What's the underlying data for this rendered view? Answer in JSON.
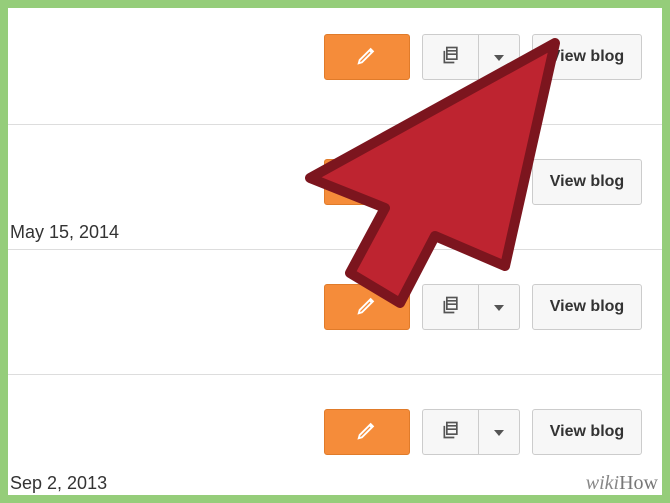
{
  "rows": [
    {
      "date": "",
      "view_label": "View blog"
    },
    {
      "date": "May 15, 2014",
      "view_label": "View blog"
    },
    {
      "date": "",
      "view_label": "View blog"
    },
    {
      "date": "Sep 2, 2013",
      "view_label": "View blog"
    }
  ],
  "icons": {
    "pencil": "pencil-icon",
    "posts": "posts-icon",
    "dropdown": "chevron-down-icon"
  },
  "watermark": {
    "prefix": "wiki",
    "suffix": "How"
  },
  "colors": {
    "frame": "#95cd7a",
    "edit_bg": "#f58c3a",
    "cursor_fill": "#be2430",
    "cursor_stroke": "#7c151e"
  }
}
